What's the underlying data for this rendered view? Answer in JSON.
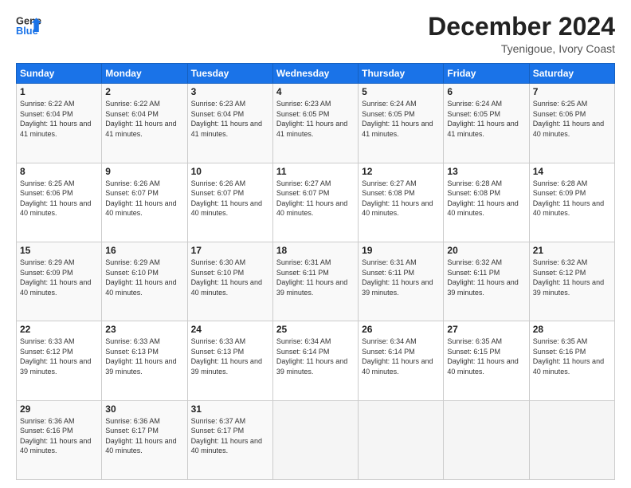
{
  "header": {
    "logo_line1": "General",
    "logo_line2": "Blue",
    "month": "December 2024",
    "location": "Tyenigoue, Ivory Coast"
  },
  "weekdays": [
    "Sunday",
    "Monday",
    "Tuesday",
    "Wednesday",
    "Thursday",
    "Friday",
    "Saturday"
  ],
  "weeks": [
    [
      {
        "day": "1",
        "sunrise": "6:22 AM",
        "sunset": "6:04 PM",
        "daylight": "11 hours and 41 minutes"
      },
      {
        "day": "2",
        "sunrise": "6:22 AM",
        "sunset": "6:04 PM",
        "daylight": "11 hours and 41 minutes"
      },
      {
        "day": "3",
        "sunrise": "6:23 AM",
        "sunset": "6:04 PM",
        "daylight": "11 hours and 41 minutes"
      },
      {
        "day": "4",
        "sunrise": "6:23 AM",
        "sunset": "6:05 PM",
        "daylight": "11 hours and 41 minutes"
      },
      {
        "day": "5",
        "sunrise": "6:24 AM",
        "sunset": "6:05 PM",
        "daylight": "11 hours and 41 minutes"
      },
      {
        "day": "6",
        "sunrise": "6:24 AM",
        "sunset": "6:05 PM",
        "daylight": "11 hours and 41 minutes"
      },
      {
        "day": "7",
        "sunrise": "6:25 AM",
        "sunset": "6:06 PM",
        "daylight": "11 hours and 40 minutes"
      }
    ],
    [
      {
        "day": "8",
        "sunrise": "6:25 AM",
        "sunset": "6:06 PM",
        "daylight": "11 hours and 40 minutes"
      },
      {
        "day": "9",
        "sunrise": "6:26 AM",
        "sunset": "6:07 PM",
        "daylight": "11 hours and 40 minutes"
      },
      {
        "day": "10",
        "sunrise": "6:26 AM",
        "sunset": "6:07 PM",
        "daylight": "11 hours and 40 minutes"
      },
      {
        "day": "11",
        "sunrise": "6:27 AM",
        "sunset": "6:07 PM",
        "daylight": "11 hours and 40 minutes"
      },
      {
        "day": "12",
        "sunrise": "6:27 AM",
        "sunset": "6:08 PM",
        "daylight": "11 hours and 40 minutes"
      },
      {
        "day": "13",
        "sunrise": "6:28 AM",
        "sunset": "6:08 PM",
        "daylight": "11 hours and 40 minutes"
      },
      {
        "day": "14",
        "sunrise": "6:28 AM",
        "sunset": "6:09 PM",
        "daylight": "11 hours and 40 minutes"
      }
    ],
    [
      {
        "day": "15",
        "sunrise": "6:29 AM",
        "sunset": "6:09 PM",
        "daylight": "11 hours and 40 minutes"
      },
      {
        "day": "16",
        "sunrise": "6:29 AM",
        "sunset": "6:10 PM",
        "daylight": "11 hours and 40 minutes"
      },
      {
        "day": "17",
        "sunrise": "6:30 AM",
        "sunset": "6:10 PM",
        "daylight": "11 hours and 40 minutes"
      },
      {
        "day": "18",
        "sunrise": "6:31 AM",
        "sunset": "6:11 PM",
        "daylight": "11 hours and 39 minutes"
      },
      {
        "day": "19",
        "sunrise": "6:31 AM",
        "sunset": "6:11 PM",
        "daylight": "11 hours and 39 minutes"
      },
      {
        "day": "20",
        "sunrise": "6:32 AM",
        "sunset": "6:11 PM",
        "daylight": "11 hours and 39 minutes"
      },
      {
        "day": "21",
        "sunrise": "6:32 AM",
        "sunset": "6:12 PM",
        "daylight": "11 hours and 39 minutes"
      }
    ],
    [
      {
        "day": "22",
        "sunrise": "6:33 AM",
        "sunset": "6:12 PM",
        "daylight": "11 hours and 39 minutes"
      },
      {
        "day": "23",
        "sunrise": "6:33 AM",
        "sunset": "6:13 PM",
        "daylight": "11 hours and 39 minutes"
      },
      {
        "day": "24",
        "sunrise": "6:33 AM",
        "sunset": "6:13 PM",
        "daylight": "11 hours and 39 minutes"
      },
      {
        "day": "25",
        "sunrise": "6:34 AM",
        "sunset": "6:14 PM",
        "daylight": "11 hours and 39 minutes"
      },
      {
        "day": "26",
        "sunrise": "6:34 AM",
        "sunset": "6:14 PM",
        "daylight": "11 hours and 40 minutes"
      },
      {
        "day": "27",
        "sunrise": "6:35 AM",
        "sunset": "6:15 PM",
        "daylight": "11 hours and 40 minutes"
      },
      {
        "day": "28",
        "sunrise": "6:35 AM",
        "sunset": "6:16 PM",
        "daylight": "11 hours and 40 minutes"
      }
    ],
    [
      {
        "day": "29",
        "sunrise": "6:36 AM",
        "sunset": "6:16 PM",
        "daylight": "11 hours and 40 minutes"
      },
      {
        "day": "30",
        "sunrise": "6:36 AM",
        "sunset": "6:17 PM",
        "daylight": "11 hours and 40 minutes"
      },
      {
        "day": "31",
        "sunrise": "6:37 AM",
        "sunset": "6:17 PM",
        "daylight": "11 hours and 40 minutes"
      },
      null,
      null,
      null,
      null
    ]
  ]
}
